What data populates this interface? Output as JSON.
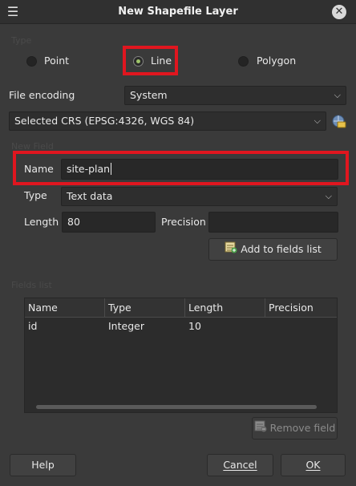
{
  "window": {
    "title": "New Shapefile Layer",
    "menu_icon": "menu-icon",
    "close_icon": "close-icon"
  },
  "type_group": {
    "label": "Type",
    "options": [
      {
        "label": "Point",
        "checked": false
      },
      {
        "label": "Line",
        "checked": true
      },
      {
        "label": "Polygon",
        "checked": false
      }
    ]
  },
  "encoding": {
    "label": "File encoding",
    "value": "System"
  },
  "crs": {
    "value": "Selected CRS (EPSG:4326, WGS 84)",
    "icon": "crs-select-icon"
  },
  "new_field": {
    "group_label": "New Field",
    "name_label": "Name",
    "name_value": "site-plan",
    "type_label": "Type",
    "type_value": "Text data",
    "length_label": "Length",
    "length_value": "80",
    "precision_label": "Precision",
    "precision_value": "",
    "add_button": "Add to fields list"
  },
  "fields_list": {
    "group_label": "Fields list",
    "columns": [
      "Name",
      "Type",
      "Length",
      "Precision"
    ],
    "rows": [
      [
        "id",
        "Integer",
        "10",
        ""
      ]
    ],
    "remove_button": "Remove field"
  },
  "buttons": {
    "help": "Help",
    "cancel": "Cancel",
    "ok": "OK"
  },
  "colors": {
    "highlight": "#e0161f",
    "radio_checked": "#9ec46a",
    "background": "#3a3a3a"
  }
}
